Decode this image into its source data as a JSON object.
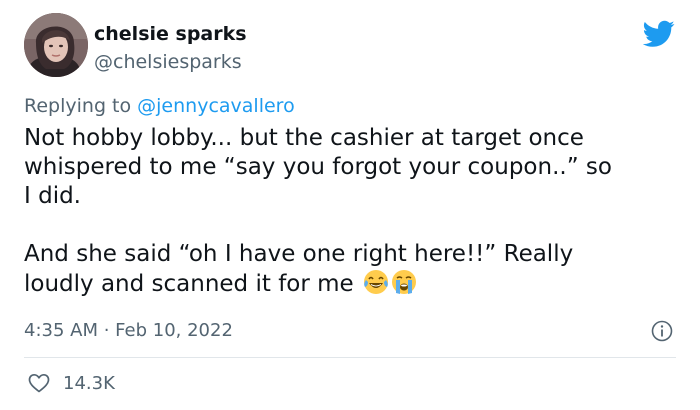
{
  "tweet": {
    "author": {
      "display_name": "chelsie sparks",
      "handle": "@chelsiesparks"
    },
    "brand_icon": "twitter-bird-icon",
    "reply_to": {
      "prefix": "Replying to ",
      "mention": "@jennycavallero"
    },
    "body": {
      "line1": "Not hobby lobby... but the cashier at target once",
      "line2": "whispered to me “say you forgot your coupon..” so",
      "line3": "I did.",
      "line4": "And she said “oh I have one right here!!” Really",
      "line5": "loudly and scanned it for me",
      "emojis": [
        "laughing-tears-emoji",
        "crying-emoji"
      ]
    },
    "timestamp": "4:35 AM · Feb 10, 2022",
    "likes": "14.3K"
  },
  "colors": {
    "text": "#0f1419",
    "secondary": "#536471",
    "accent": "#1d9bf0",
    "divider": "#e1e6ea"
  }
}
